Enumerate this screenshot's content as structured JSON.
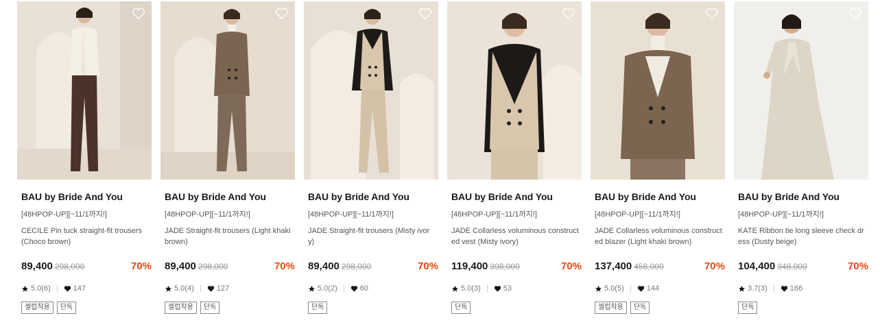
{
  "colors": {
    "discount": "#e8470e",
    "text": "#1a1a1a",
    "muted": "#555555"
  },
  "products": [
    {
      "brand": "BAU by Bride And You",
      "promo": "[48HPOP-UP][~11/1까지!]",
      "name": "CECILE Pin tuck straight-fit trousers (Choco brown)",
      "price": "89,400",
      "original_price": "298,000",
      "discount": "70%",
      "rating": "5.0(6)",
      "likes": "147",
      "tags": [
        "셀럽착용",
        "단독"
      ],
      "wishlist_icon": "heart-outline-icon"
    },
    {
      "brand": "BAU by Bride And You",
      "promo": "[48HPOP-UP][~11/1까지!]",
      "name": "JADE Straight-fit trousers (Light khaki brown)",
      "price": "89,400",
      "original_price": "298,000",
      "discount": "70%",
      "rating": "5.0(4)",
      "likes": "127",
      "tags": [
        "셀럽착용",
        "단독"
      ],
      "wishlist_icon": "heart-outline-icon"
    },
    {
      "brand": "BAU by Bride And You",
      "promo": "[48HPOP-UP][~11/1까지!]",
      "name": "JADE Straight-fit trousers (Misty ivory)",
      "price": "89,400",
      "original_price": "298,000",
      "discount": "70%",
      "rating": "5.0(2)",
      "likes": "60",
      "tags": [
        "단독"
      ],
      "wishlist_icon": "heart-outline-icon"
    },
    {
      "brand": "BAU by Bride And You",
      "promo": "[48HPOP-UP][~11/1까지!]",
      "name": "JADE Collarless voluminous constructed vest (Misty ivory)",
      "price": "119,400",
      "original_price": "398,000",
      "discount": "70%",
      "rating": "5.0(3)",
      "likes": "53",
      "tags": [
        "단독"
      ],
      "wishlist_icon": "heart-outline-icon"
    },
    {
      "brand": "BAU by Bride And You",
      "promo": "[48HPOP-UP][~11/1까지!]",
      "name": "JADE Collarless voluminous constructed blazer (Light khaki brown)",
      "price": "137,400",
      "original_price": "458,000",
      "discount": "70%",
      "rating": "5.0(5)",
      "likes": "144",
      "tags": [
        "셀럽착용",
        "단독"
      ],
      "wishlist_icon": "heart-outline-icon"
    },
    {
      "brand": "BAU by Bride And You",
      "promo": "[48HPOP-UP][~11/1까지!]",
      "name": "KATE Ribbon tie long sleeve check dress (Dusty beige)",
      "price": "104,400",
      "original_price": "348,000",
      "discount": "70%",
      "rating": "3.7(3)",
      "likes": "166",
      "tags": [
        "단독"
      ],
      "wishlist_icon": "heart-outline-icon"
    }
  ]
}
